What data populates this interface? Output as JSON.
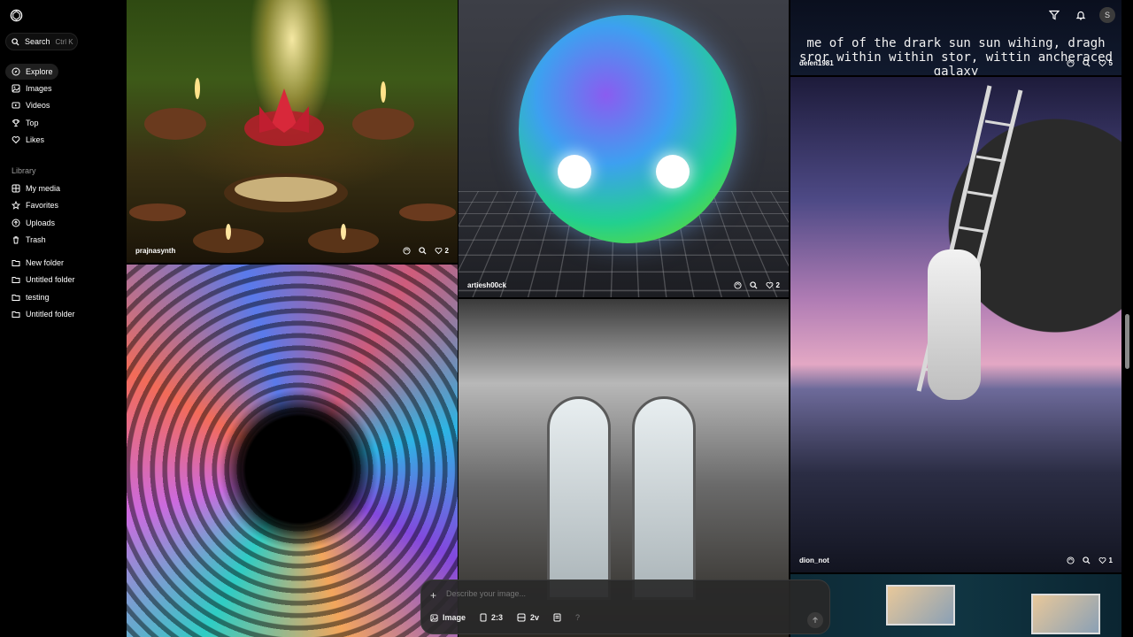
{
  "sidebar": {
    "search_label": "Search",
    "search_shortcut": "Ctrl K",
    "nav": [
      {
        "label": "Explore",
        "icon": "compass-icon"
      },
      {
        "label": "Images",
        "icon": "image-icon"
      },
      {
        "label": "Videos",
        "icon": "video-icon"
      },
      {
        "label": "Top",
        "icon": "trophy-icon"
      },
      {
        "label": "Likes",
        "icon": "heart-icon"
      }
    ],
    "library_label": "Library",
    "library": [
      {
        "label": "My media",
        "icon": "media-icon"
      },
      {
        "label": "Favorites",
        "icon": "star-icon"
      },
      {
        "label": "Uploads",
        "icon": "upload-icon"
      },
      {
        "label": "Trash",
        "icon": "trash-icon"
      }
    ],
    "folders": [
      {
        "label": "New folder"
      },
      {
        "label": "Untitled folder"
      },
      {
        "label": "testing"
      },
      {
        "label": "Untitled folder"
      }
    ]
  },
  "tiles": {
    "candles": {
      "user": "prajnasynth",
      "likes": "2"
    },
    "orb": {
      "user": "artiesh00ck",
      "likes": "2"
    },
    "galaxy": {
      "user": "delen1981",
      "likes": "5",
      "caption": "me of of the drark sun sun wihing, dragh sror within within stor, wittin ancheraced galaxy"
    },
    "astronaut": {
      "user": "dion_not",
      "likes": "1"
    }
  },
  "topbar": {
    "avatar_initial": "S"
  },
  "prompt": {
    "placeholder": "Describe your image...",
    "mode": "Image",
    "ratio": "2:3",
    "variations": "2v",
    "help": "?"
  },
  "colors": {
    "background": "#000000",
    "surface": "#1f1f1f",
    "muted": "#9a9a9a"
  }
}
